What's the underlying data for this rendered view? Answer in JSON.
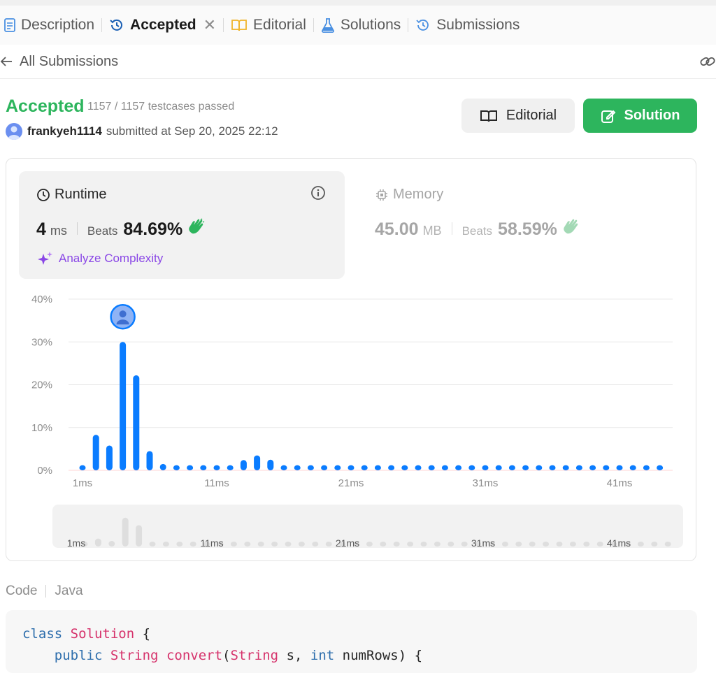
{
  "tabs": [
    {
      "label": "Description",
      "icon": "description-doc-icon"
    },
    {
      "label": "Accepted",
      "icon": "history-icon",
      "active": true,
      "close": "✕"
    },
    {
      "label": "Editorial",
      "icon": "book-icon"
    },
    {
      "label": "Solutions",
      "icon": "flask-icon"
    },
    {
      "label": "Submissions",
      "icon": "history-icon"
    }
  ],
  "nav": {
    "back_label": "All Submissions"
  },
  "submission": {
    "status": "Accepted",
    "testcases": "1157 / 1157 testcases passed",
    "user": "frankyeh1114",
    "submitted_at": "submitted at Sep 20, 2025 22:12"
  },
  "buttons": {
    "editorial": "Editorial",
    "solution": "Solution"
  },
  "runtime": {
    "title": "Runtime",
    "value": "4",
    "unit": "ms",
    "beats_label": "Beats",
    "beats_value": "84.69%",
    "analyze": "Analyze Complexity"
  },
  "memory": {
    "title": "Memory",
    "value": "45.00",
    "unit": "MB",
    "beats_label": "Beats",
    "beats_value": "58.59%"
  },
  "colors": {
    "accepted": "#2db55d",
    "bar": "#0a7cff",
    "accent_purple": "#8a47e6"
  },
  "chart_data": {
    "type": "bar",
    "y_ticks": [
      "40%",
      "30%",
      "20%",
      "10%",
      "0%"
    ],
    "ylim": [
      0,
      40
    ],
    "x_tick_labels": [
      "1ms",
      "11ms",
      "21ms",
      "31ms",
      "41ms"
    ],
    "x": [
      1,
      2,
      3,
      4,
      5,
      6,
      7,
      8,
      9,
      10,
      11,
      12,
      13,
      14,
      15,
      16,
      17,
      18,
      19,
      20,
      21,
      22,
      23,
      24,
      25,
      26,
      27,
      28,
      29,
      30,
      31,
      32,
      33,
      34,
      35,
      36,
      37,
      38,
      39,
      40,
      41,
      42,
      43,
      44
    ],
    "values": [
      1.2,
      8.3,
      5.8,
      30.0,
      22.2,
      4.5,
      1.5,
      1.2,
      1.2,
      1.2,
      1.2,
      1.2,
      2.4,
      3.5,
      2.5,
      1.2,
      1.2,
      1.2,
      1.2,
      1.2,
      1.2,
      1.2,
      1.2,
      1.2,
      1.2,
      1.2,
      1.2,
      1.2,
      1.2,
      1.2,
      1.2,
      1.2,
      1.2,
      1.2,
      1.2,
      1.2,
      1.2,
      1.2,
      1.2,
      1.2,
      1.2,
      1.2,
      1.2,
      1.2
    ],
    "highlight_x": 4,
    "grid": true
  },
  "code_section": {
    "label": "Code",
    "language": "Java"
  },
  "code_lines": [
    {
      "kw": "class",
      "rest": " Solution {",
      "cls": "Solution"
    },
    {
      "text": "    public String convert(String s, int numRows) {"
    }
  ]
}
